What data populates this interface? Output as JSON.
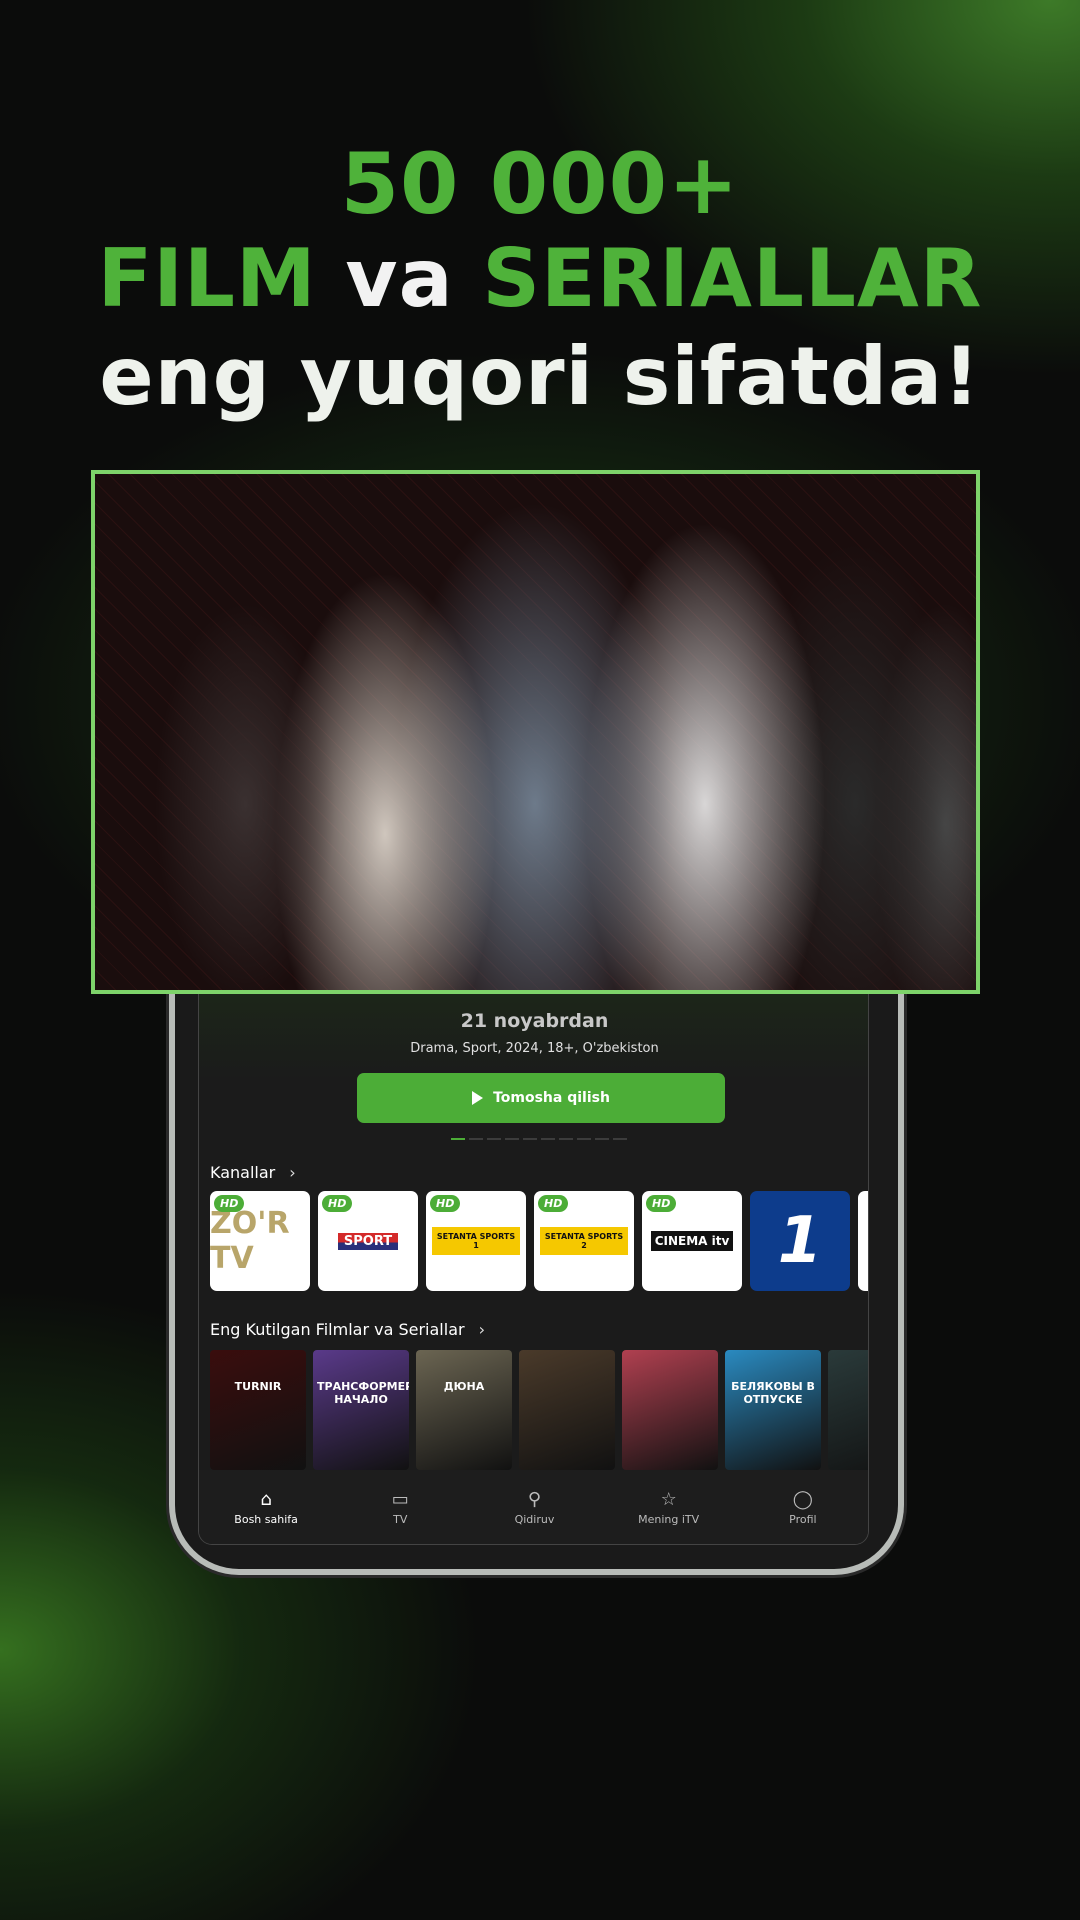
{
  "headline": {
    "line1": "50 000+",
    "film": "FILM",
    "va": "va",
    "seriallar": "SERIALLAR",
    "line3": "eng yuqori sifatda!"
  },
  "hero": {
    "date": "21 noyabrdan",
    "genres": "Drama, Sport, 2024, 18+, O'zbekiston",
    "watch_label": "Tomosha qilish",
    "slides": 10,
    "active_slide": 1
  },
  "channels": {
    "title": "Kanallar",
    "items": [
      {
        "name": "ZO'R TV",
        "hd": "HD"
      },
      {
        "name": "SPORT",
        "hd": "HD"
      },
      {
        "name": "SETANTA SPORTS 1",
        "hd": "HD"
      },
      {
        "name": "SETANTA SPORTS 2",
        "hd": "HD"
      },
      {
        "name": "CINEMA itv",
        "hd": "HD"
      },
      {
        "name": "1"
      }
    ]
  },
  "movies": {
    "title": "Eng Kutilgan Filmlar va Seriallar",
    "items": [
      {
        "title": "TURNIR",
        "color": "#3a0d0d"
      },
      {
        "title": "ТРАНСФОРМЕРЫ НАЧАЛО",
        "color": "#5a3a8a"
      },
      {
        "title": "ДЮНА",
        "color": "#6b6552"
      },
      {
        "title": "",
        "color": "#4a3a2a"
      },
      {
        "title": "",
        "color": "#b04050"
      },
      {
        "title": "БЕЛЯКОВЫ В ОТПУСКЕ",
        "color": "#2a8ac0"
      },
      {
        "title": "",
        "color": "#2a3a3a"
      }
    ]
  },
  "nav": [
    {
      "label": "Bosh sahifa",
      "icon": "home-icon"
    },
    {
      "label": "TV",
      "icon": "tv-icon"
    },
    {
      "label": "Qidiruv",
      "icon": "search-icon"
    },
    {
      "label": "Mening iTV",
      "icon": "star-icon"
    },
    {
      "label": "Profil",
      "icon": "user-icon"
    }
  ],
  "colors": {
    "accent": "#4cad37",
    "border": "#7ed36a"
  }
}
